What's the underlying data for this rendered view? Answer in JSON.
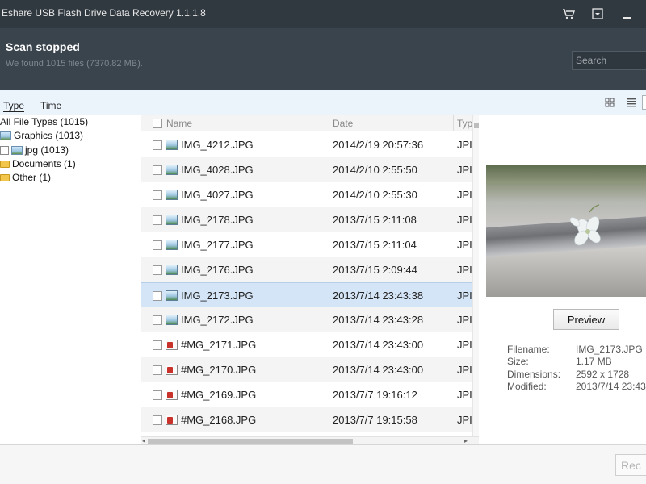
{
  "window": {
    "title": "Eshare USB Flash Drive Data Recovery 1.1.1.8",
    "icons": [
      "cart-icon",
      "dropdown-menu-icon",
      "minimize-icon"
    ]
  },
  "status": {
    "title": "Scan stopped",
    "subtitle": "We found 1015 files (7370.82 MB).",
    "search_placeholder": "Search"
  },
  "viewbar": {
    "tabs": [
      {
        "label": "Type",
        "active": true
      },
      {
        "label": "Time",
        "active": false
      }
    ],
    "icons": [
      "grid-view-icon",
      "list-view-icon",
      "detail-view-icon"
    ]
  },
  "tree": [
    {
      "label": "All File Types (1015)"
    },
    {
      "label": "Graphics (1013)"
    },
    {
      "label": "jpg (1013)"
    },
    {
      "label": "Documents (1)"
    },
    {
      "label": "Other (1)"
    }
  ],
  "filelist": {
    "columns": [
      "Name",
      "Date",
      "Typ"
    ],
    "rows": [
      {
        "name": "IMG_4212.JPG",
        "date": "2014/2/19 20:57:36",
        "type": "JPI",
        "icon": "image",
        "selected": false
      },
      {
        "name": "IMG_4028.JPG",
        "date": "2014/2/10 2:55:50",
        "type": "JPI",
        "icon": "image",
        "selected": false
      },
      {
        "name": "IMG_4027.JPG",
        "date": "2014/2/10 2:55:30",
        "type": "JPI",
        "icon": "image",
        "selected": false
      },
      {
        "name": "IMG_2178.JPG",
        "date": "2013/7/15 2:11:08",
        "type": "JPI",
        "icon": "image",
        "selected": false
      },
      {
        "name": "IMG_2177.JPG",
        "date": "2013/7/15 2:11:04",
        "type": "JPI",
        "icon": "image",
        "selected": false
      },
      {
        "name": "IMG_2176.JPG",
        "date": "2013/7/15 2:09:44",
        "type": "JPI",
        "icon": "image",
        "selected": false
      },
      {
        "name": "IMG_2173.JPG",
        "date": "2013/7/14 23:43:38",
        "type": "JPI",
        "icon": "image",
        "selected": true
      },
      {
        "name": "IMG_2172.JPG",
        "date": "2013/7/14 23:43:28",
        "type": "JPI",
        "icon": "image",
        "selected": false
      },
      {
        "name": "#MG_2171.JPG",
        "date": "2013/7/14 23:43:00",
        "type": "JPI",
        "icon": "deleted",
        "selected": false
      },
      {
        "name": "#MG_2170.JPG",
        "date": "2013/7/14 23:43:00",
        "type": "JPI",
        "icon": "deleted",
        "selected": false
      },
      {
        "name": "#MG_2169.JPG",
        "date": "2013/7/7 19:16:12",
        "type": "JPI",
        "icon": "deleted",
        "selected": false
      },
      {
        "name": "#MG_2168.JPG",
        "date": "2013/7/7 19:15:58",
        "type": "JPI",
        "icon": "deleted",
        "selected": false
      }
    ]
  },
  "preview": {
    "button_label": "Preview",
    "meta": [
      {
        "label": "Filename:",
        "value": "IMG_2173.JPG"
      },
      {
        "label": "Size:",
        "value": "1.17 MB"
      },
      {
        "label": "Dimensions:",
        "value": "2592 x 1728"
      },
      {
        "label": "Modified:",
        "value": "2013/7/14 23:43"
      }
    ]
  },
  "footer": {
    "recover_label": "Rec"
  }
}
